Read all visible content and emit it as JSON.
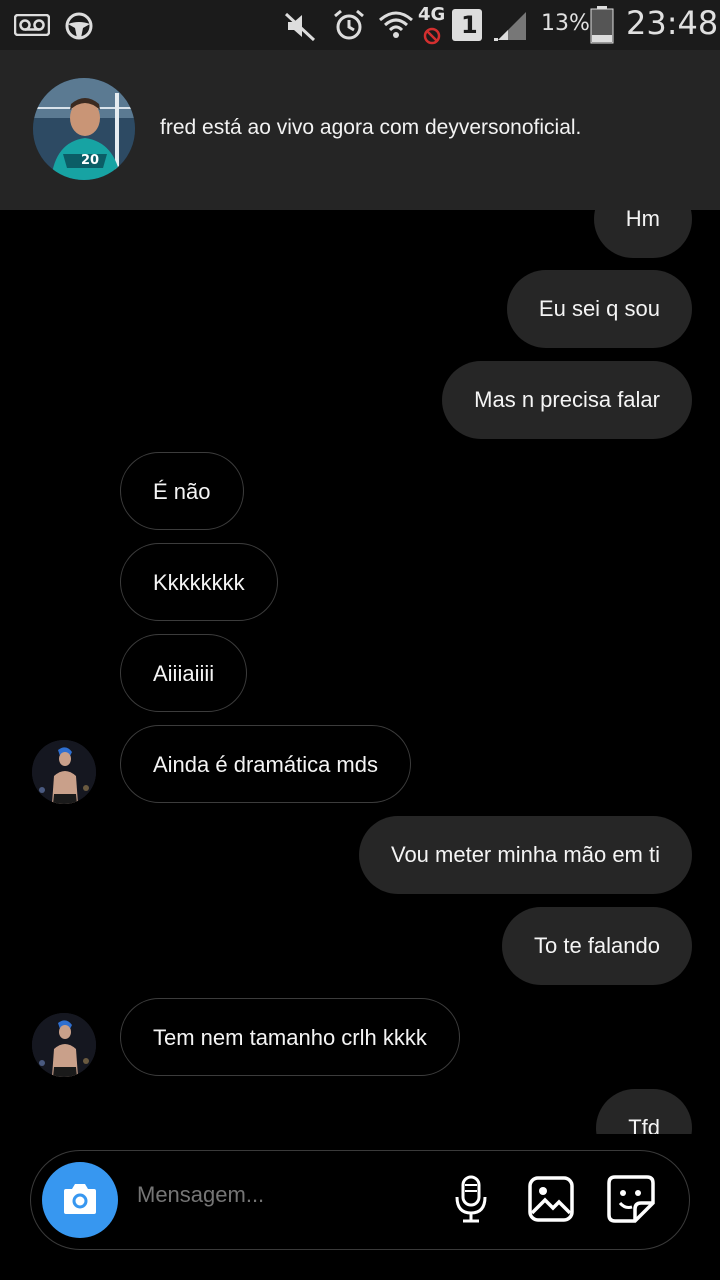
{
  "status_bar": {
    "battery": "13%",
    "time": "23:48",
    "network": "4G",
    "sim": "1",
    "icons": [
      "voicemail-icon",
      "steering-wheel-icon",
      "mute-icon",
      "alarm-icon",
      "wifi-icon",
      "network-4g-icon",
      "sim-icon",
      "signal-icon",
      "battery-icon"
    ]
  },
  "notification": {
    "text": "fred está ao vivo agora com deyversonoficial."
  },
  "messages": [
    {
      "side": "out",
      "text": "Hm"
    },
    {
      "side": "out",
      "text": "Eu sei q sou"
    },
    {
      "side": "out",
      "text": "Mas n precisa falar"
    },
    {
      "side": "in",
      "text": "É não"
    },
    {
      "side": "in",
      "text": "Kkkkkkkk"
    },
    {
      "side": "in",
      "text": "Aiiiaiiii"
    },
    {
      "side": "in",
      "text": "Ainda é dramática mds"
    },
    {
      "side": "out",
      "text": "Vou meter minha mão em ti"
    },
    {
      "side": "out",
      "text": "To te falando"
    },
    {
      "side": "in",
      "text": "Tem nem tamanho crlh kkkk"
    },
    {
      "side": "out",
      "text": "Tfd"
    }
  ],
  "composer": {
    "placeholder": "Mensagem...",
    "icons": [
      "camera-icon",
      "microphone-icon",
      "gallery-icon",
      "sticker-icon"
    ],
    "accent_color": "#3797f0"
  }
}
